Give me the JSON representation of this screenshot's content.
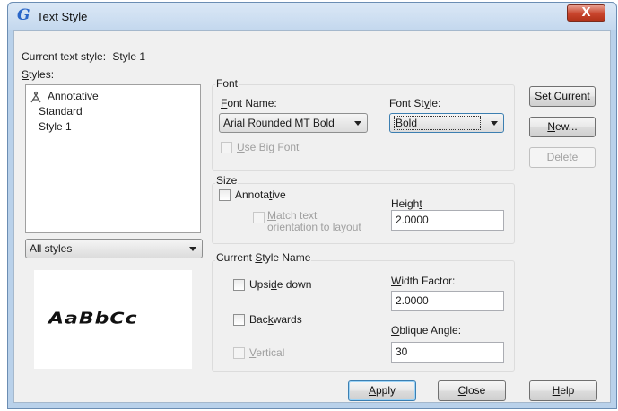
{
  "window": {
    "title": "Text Style",
    "close_glyph": "X"
  },
  "current_style": {
    "label": "Current text style:",
    "value": "Style 1"
  },
  "styles": {
    "label_accel": "S",
    "label_rest": "tyles:",
    "items": [
      "Annotative",
      "Standard",
      "Style 1"
    ],
    "filter_value": "All styles"
  },
  "preview": {
    "sample": "AaBbCc"
  },
  "font_group": {
    "title": "Font",
    "font_name_label_accel": "F",
    "font_name_label_rest": "ont Name:",
    "font_name_value": "Arial Rounded MT Bold",
    "font_style_label_pre": "Font St",
    "font_style_label_accel": "y",
    "font_style_label_rest": "le:",
    "font_style_value": "Bold",
    "big_font_accel": "U",
    "big_font_rest": "se Big Font"
  },
  "size_group": {
    "title": "Size",
    "annotative_pre": "Annota",
    "annotative_accel": "t",
    "annotative_rest": "ive",
    "match_accel": "M",
    "match_line1_rest": "atch text",
    "match_line2": "orientation to layout",
    "height_pre": "Heigh",
    "height_accel": "t",
    "height_value": "2.0000"
  },
  "effects_group": {
    "title_pre": "Current ",
    "title_accel": "S",
    "title_rest": "tyle Name",
    "upside_pre": "Upsi",
    "upside_accel": "d",
    "upside_rest": "e down",
    "backwards_pre": "Bac",
    "backwards_accel": "k",
    "backwards_rest": "wards",
    "vertical_accel": "V",
    "vertical_rest": "ertical",
    "width_accel": "W",
    "width_rest": "idth Factor:",
    "width_value": "2.0000",
    "oblique_accel": "O",
    "oblique_rest": "blique Angle:",
    "oblique_value": "30"
  },
  "side_buttons": {
    "set_current_pre": "Set ",
    "set_current_accel": "C",
    "set_current_rest": "urrent",
    "new_accel": "N",
    "new_rest": "ew...",
    "delete_accel": "D",
    "delete_rest": "elete"
  },
  "bottom_buttons": {
    "apply_accel": "A",
    "apply_rest": "pply",
    "close_accel": "C",
    "close_rest": "lose",
    "help_accel": "H",
    "help_rest": "elp"
  }
}
